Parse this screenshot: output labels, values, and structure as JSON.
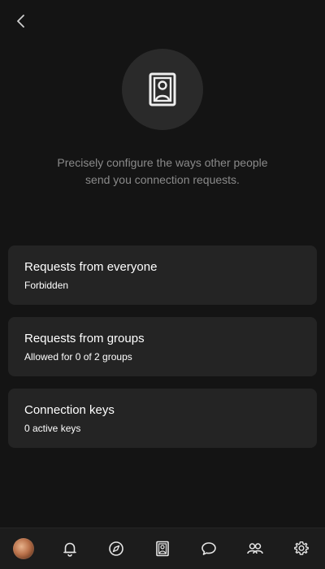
{
  "header": {
    "back_icon": "chevron-left-icon",
    "hero_icon": "contact-book-icon"
  },
  "description": {
    "line1": "Precisely configure the ways other people",
    "line2": "send you connection requests."
  },
  "settings": [
    {
      "title": "Requests from everyone",
      "subtitle": "Forbidden"
    },
    {
      "title": "Requests from groups",
      "subtitle": "Allowed for 0 of 2 groups"
    },
    {
      "title": "Connection keys",
      "subtitle": "0 active keys"
    }
  ],
  "tabbar": {
    "items": [
      {
        "name": "profile",
        "icon": "avatar"
      },
      {
        "name": "notifications",
        "icon": "bell-icon"
      },
      {
        "name": "explore",
        "icon": "compass-icon"
      },
      {
        "name": "contacts",
        "icon": "contact-book-icon"
      },
      {
        "name": "chats",
        "icon": "chat-bubble-icon"
      },
      {
        "name": "groups",
        "icon": "people-icon"
      },
      {
        "name": "settings",
        "icon": "gear-icon"
      }
    ]
  },
  "colors": {
    "background": "#141414",
    "card": "#242424",
    "muted_text": "#8a8a8a",
    "icon": "#e6e6e6"
  }
}
